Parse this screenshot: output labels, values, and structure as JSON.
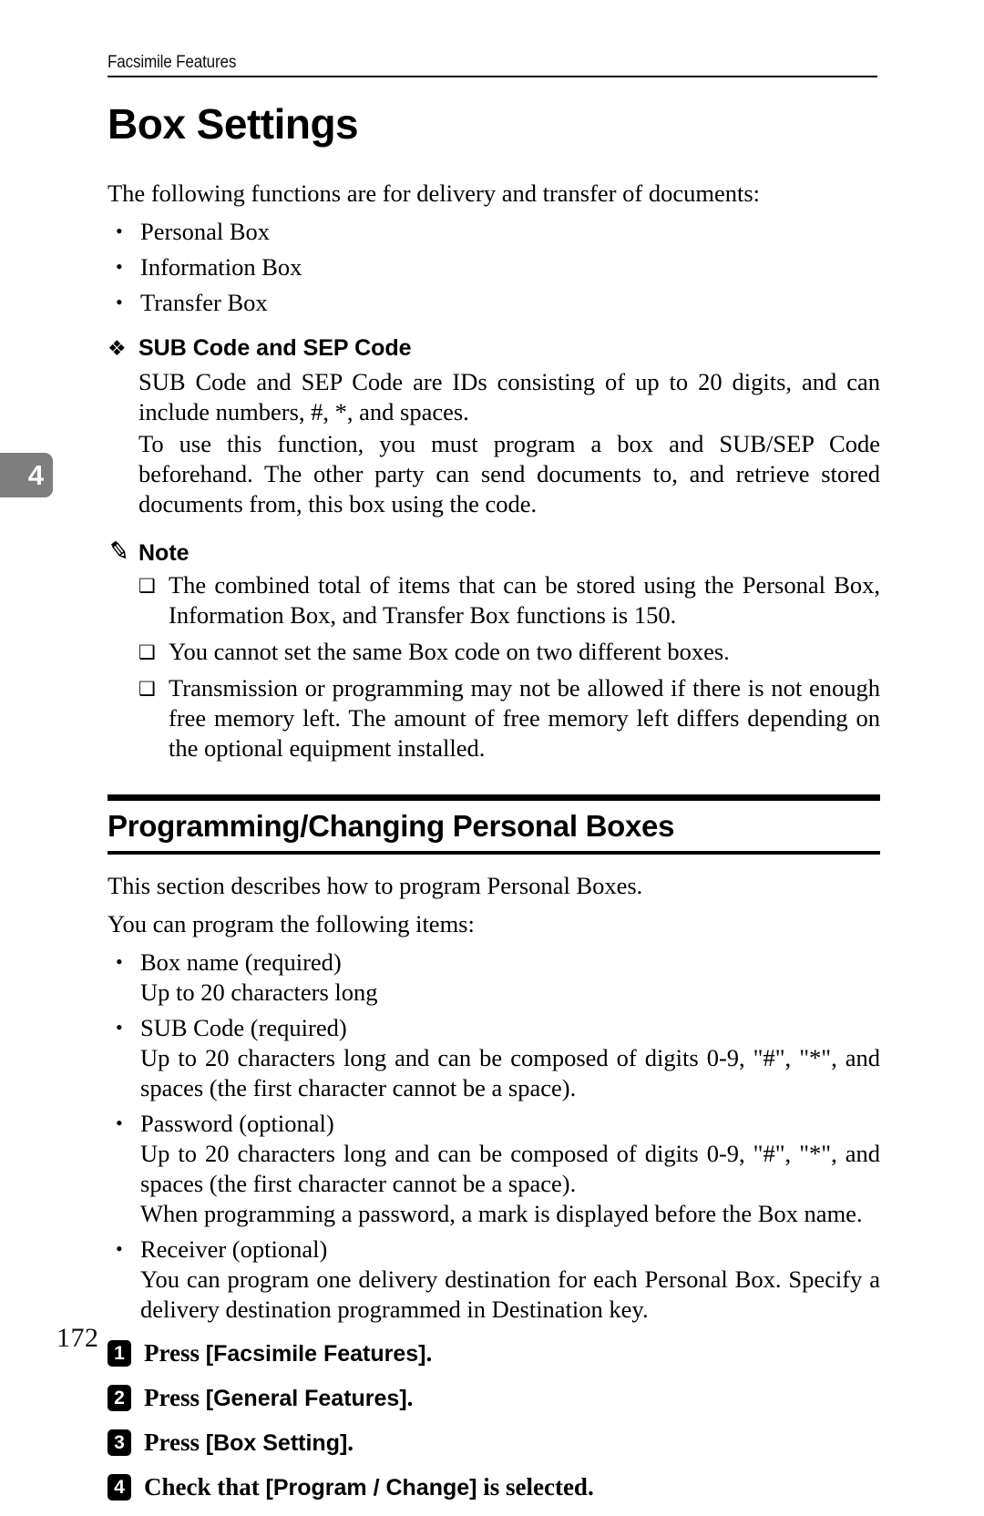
{
  "running_header": {
    "text": "Facsimile Features"
  },
  "chapter_tab": {
    "number": "4"
  },
  "folio": {
    "page_number": "172"
  },
  "title": "Box Settings",
  "intro": {
    "lead": "The following functions are for delivery and transfer of documents:",
    "items": [
      "Personal Box",
      " Information Box",
      "Transfer Box"
    ]
  },
  "sub_sep": {
    "glyph": "❖",
    "heading": "SUB Code and SEP Code",
    "paragraphs": [
      "SUB Code and SEP Code are IDs consisting of up to 20 digits, and can include numbers, #, *, and spaces.",
      "To use this function, you must program a box and SUB/SEP Code beforehand. The other party can send documents to, and retrieve stored documents from, this box using the code."
    ]
  },
  "note": {
    "icon": "pencil-icon",
    "heading": "Note",
    "items": [
      "The combined total of items that can be stored using the Personal Box, Information Box, and Transfer Box functions is 150.",
      "You cannot set the same Box code on two different boxes.",
      "Transmission or programming may not be allowed if there is not enough free memory left. The amount of free memory left differs depending on the optional equipment installed."
    ]
  },
  "section": {
    "heading": "Programming/Changing Personal Boxes",
    "paragraphs": [
      "This section describes how to program Personal Boxes.",
      "You can program the following items:"
    ],
    "items": [
      {
        "label": "Box name (required)",
        "lines": [
          "Up to 20 characters long"
        ]
      },
      {
        "label": "SUB Code (required)",
        "lines": [
          "Up to 20 characters long and can be composed of digits 0-9, \"#\", \"*\", and spaces (the first character cannot be a space)."
        ]
      },
      {
        "label": "Password (optional)",
        "lines": [
          "Up to 20 characters long and can be composed of digits 0-9, \"#\", \"*\", and spaces (the first character cannot be a space).",
          "When programming a password, a mark is displayed before the Box name."
        ]
      },
      {
        "label": "Receiver (optional)",
        "lines": [
          "You can program one delivery destination for each Personal Box. Specify a delivery destination programmed in Destination key."
        ]
      }
    ]
  },
  "steps": [
    {
      "number": "1",
      "prefix": "Press ",
      "key": "[Facsimile Features]",
      "suffix": "."
    },
    {
      "number": "2",
      "prefix": "Press ",
      "key": "[General Features]",
      "suffix": "."
    },
    {
      "number": "3",
      "prefix": "Press ",
      "key": "[Box Setting]",
      "suffix": "."
    },
    {
      "number": "4",
      "prefix": "Check that ",
      "key": "[Program / Change]",
      "suffix": " is selected."
    }
  ]
}
